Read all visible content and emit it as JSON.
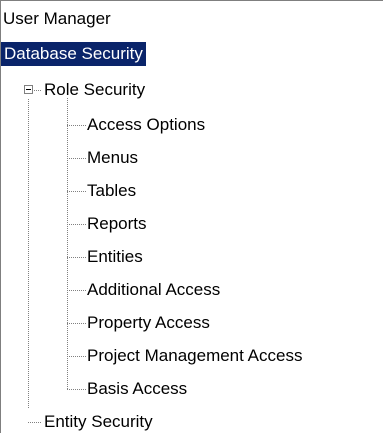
{
  "tree": {
    "top_items": [
      "User Manager",
      "Database Security"
    ],
    "selected_index": 1,
    "role_security": {
      "label": "Role Security",
      "expanded": true,
      "children": [
        "Access Options",
        "Menus",
        "Tables",
        "Reports",
        "Entities",
        "Additional Access",
        "Property Access",
        "Project Management Access",
        "Basis Access"
      ]
    },
    "entity_security": {
      "label": "Entity Security"
    }
  },
  "colors": {
    "selection_bg": "#0a246a",
    "selection_text": "#ffffff",
    "tree_lines": "#808080"
  },
  "icons": {
    "expander": "minus-box-icon"
  }
}
